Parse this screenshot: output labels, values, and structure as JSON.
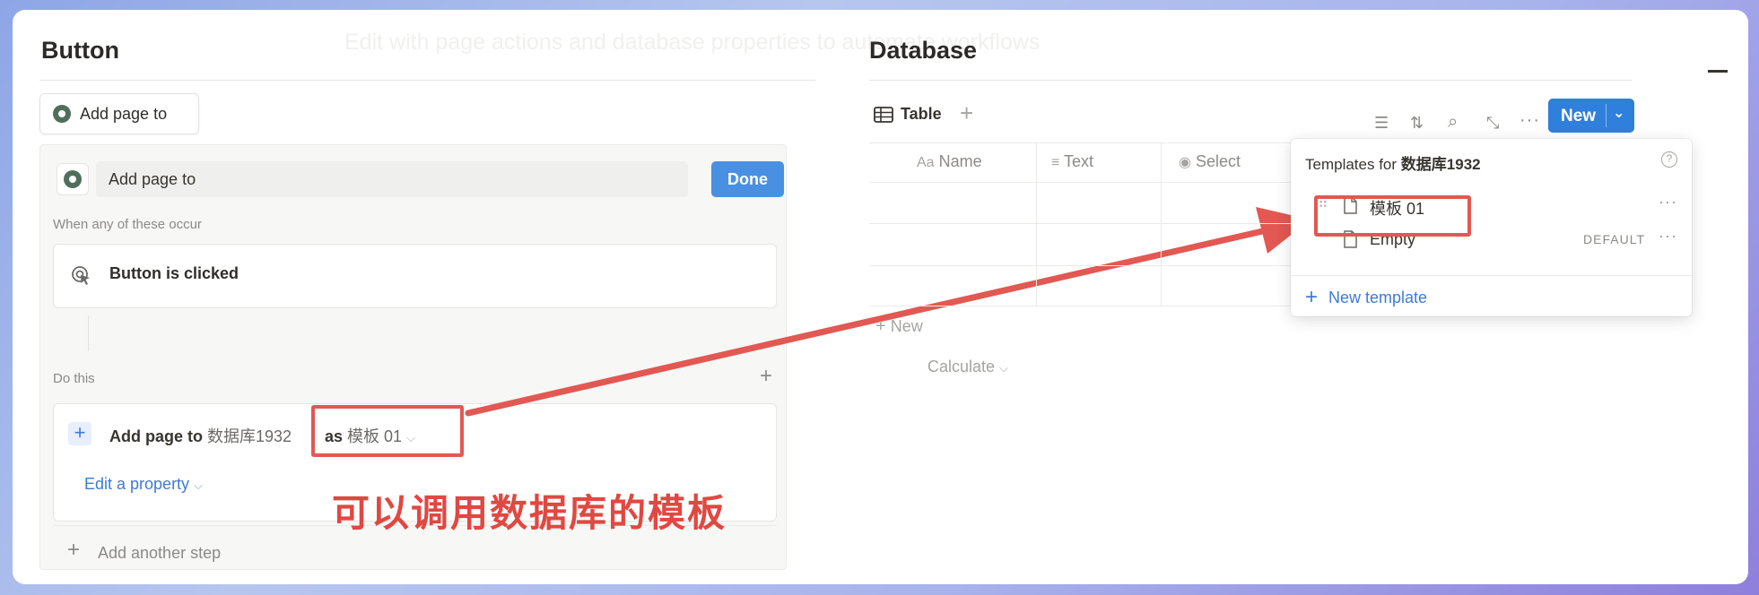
{
  "faded_text": "Edit with page actions and database properties to automate workflows",
  "left": {
    "title": "Button",
    "chip_label": "Add page to",
    "editor": {
      "name_value": "Add page to",
      "done_label": "Done",
      "trigger_section": "When any of these occur",
      "trigger": "Button is clicked",
      "action_section": "Do this",
      "step_prefix": "Add page to",
      "step_db": "数据库1932",
      "step_as": "as",
      "step_template": "模板 01",
      "edit_property": "Edit a property",
      "add_step": "Add another step"
    }
  },
  "annotation": "可以调用数据库的模板",
  "right": {
    "title": "Database",
    "view_tab": "Table",
    "new_label": "New",
    "columns": [
      "Name",
      "Text",
      "Select"
    ],
    "column_prefix_name": "Aa",
    "add_row": "New",
    "calculate": "Calculate",
    "dropdown": {
      "title_prefix": "Templates for",
      "title_db": "数据库1932",
      "templates": [
        {
          "label": "模板 01",
          "tag": ""
        },
        {
          "label": "Empty",
          "tag": "DEFAULT"
        }
      ],
      "new_template": "New template"
    }
  },
  "colors": {
    "accent_blue": "#2f7fdc",
    "highlight_red": "#e25852",
    "annotation_red": "#e04841"
  }
}
